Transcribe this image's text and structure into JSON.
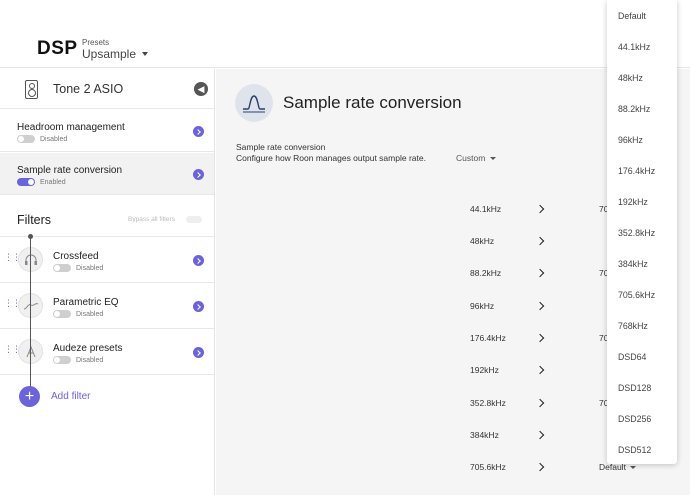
{
  "header": {
    "title": "DSP",
    "presets_label": "Presets",
    "presets_value": "Upsample"
  },
  "device": {
    "name": "Tone 2 ASIO"
  },
  "nav": [
    {
      "label": "Headroom management",
      "status": "Disabled",
      "enabled": false
    },
    {
      "label": "Sample rate conversion",
      "status": "Enabled",
      "enabled": true
    }
  ],
  "filters": {
    "title": "Filters",
    "bypass_label": "Bypass all filters",
    "items": [
      {
        "name": "Crossfeed",
        "status": "Disabled",
        "icon": "headphones-icon"
      },
      {
        "name": "Parametric EQ",
        "status": "Disabled",
        "icon": "eq-curve-icon"
      },
      {
        "name": "Audeze presets",
        "status": "Disabled",
        "icon": "audeze-logo-icon"
      }
    ],
    "add_label": "Add filter"
  },
  "main": {
    "title": "Sample rate conversion",
    "desc_title": "Sample rate conversion",
    "desc_body": "Configure how Roon manages output sample rate.",
    "mode": "Custom",
    "rows": [
      {
        "in": "44.1kHz",
        "out": "70"
      },
      {
        "in": "48kHz",
        "out": ""
      },
      {
        "in": "88.2kHz",
        "out": "70"
      },
      {
        "in": "96kHz",
        "out": ""
      },
      {
        "in": "176.4kHz",
        "out": "70"
      },
      {
        "in": "192kHz",
        "out": ""
      },
      {
        "in": "352.8kHz",
        "out": "70"
      },
      {
        "in": "384kHz",
        "out": ""
      },
      {
        "in": "705.6kHz",
        "out": "Default"
      }
    ]
  },
  "dropdown": {
    "options": [
      "Default",
      "44.1kHz",
      "48kHz",
      "88.2kHz",
      "96kHz",
      "176.4kHz",
      "192kHz",
      "352.8kHz",
      "384kHz",
      "705.6kHz",
      "768kHz",
      "DSD64",
      "DSD128",
      "DSD256",
      "DSD512"
    ]
  },
  "colors": {
    "accent": "#6a63d9",
    "panel": "#f5f5f5"
  }
}
